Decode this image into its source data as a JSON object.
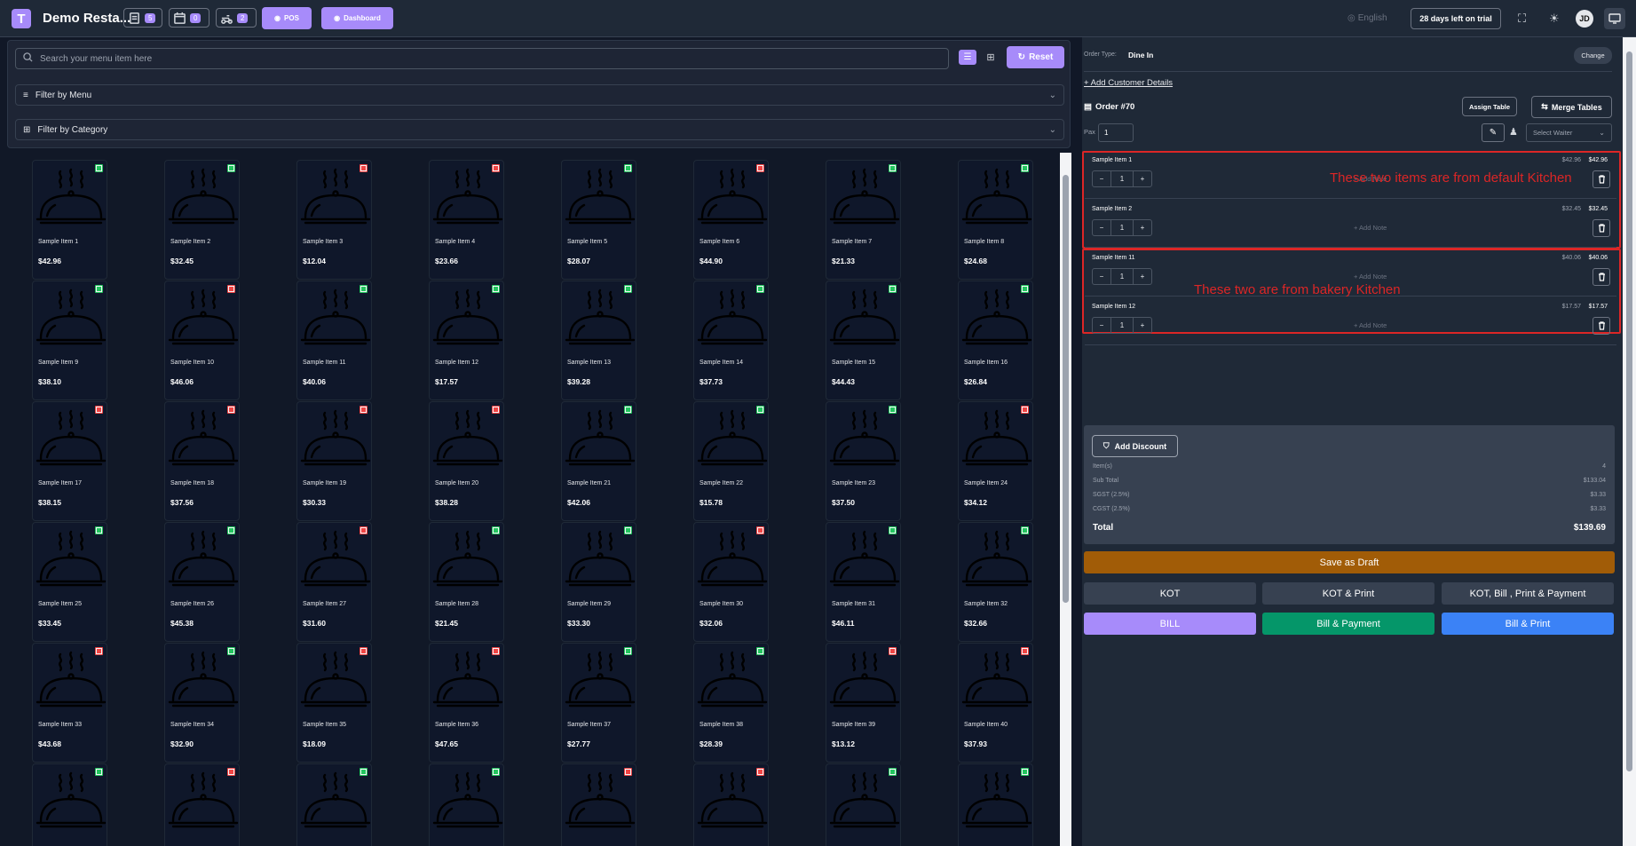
{
  "header": {
    "logo_letter": "T",
    "restaurant_name": "Demo Resta...",
    "badges": [
      {
        "icon": "receipt-icon",
        "count": "5"
      },
      {
        "icon": "calendar-icon",
        "count": "0"
      },
      {
        "icon": "delivery-icon",
        "count": "2"
      }
    ],
    "pos_label": "POS",
    "dashboard_label": "Dashboard",
    "language": "English",
    "trial": "28 days left on trial",
    "avatar": "JD"
  },
  "filters": {
    "search_placeholder": "Search your menu item here",
    "reset_label": "Reset",
    "filter_menu": "Filter by Menu",
    "filter_category": "Filter by Category"
  },
  "menu_items": [
    {
      "name": "Sample Item 1",
      "price": "$42.96",
      "veg": true
    },
    {
      "name": "Sample Item 2",
      "price": "$32.45",
      "veg": true
    },
    {
      "name": "Sample Item 3",
      "price": "$12.04",
      "veg": false
    },
    {
      "name": "Sample Item 4",
      "price": "$23.66",
      "veg": false
    },
    {
      "name": "Sample Item 5",
      "price": "$28.07",
      "veg": true
    },
    {
      "name": "Sample Item 6",
      "price": "$44.90",
      "veg": false
    },
    {
      "name": "Sample Item 7",
      "price": "$21.33",
      "veg": true
    },
    {
      "name": "Sample Item 8",
      "price": "$24.68",
      "veg": true
    },
    {
      "name": "Sample Item 9",
      "price": "$38.10",
      "veg": true
    },
    {
      "name": "Sample Item 10",
      "price": "$46.06",
      "veg": false
    },
    {
      "name": "Sample Item 11",
      "price": "$40.06",
      "veg": true
    },
    {
      "name": "Sample Item 12",
      "price": "$17.57",
      "veg": true
    },
    {
      "name": "Sample Item 13",
      "price": "$39.28",
      "veg": true
    },
    {
      "name": "Sample Item 14",
      "price": "$37.73",
      "veg": true
    },
    {
      "name": "Sample Item 15",
      "price": "$44.43",
      "veg": true
    },
    {
      "name": "Sample Item 16",
      "price": "$26.84",
      "veg": true
    },
    {
      "name": "Sample Item 17",
      "price": "$38.15",
      "veg": false
    },
    {
      "name": "Sample Item 18",
      "price": "$37.56",
      "veg": false
    },
    {
      "name": "Sample Item 19",
      "price": "$30.33",
      "veg": false
    },
    {
      "name": "Sample Item 20",
      "price": "$38.28",
      "veg": false
    },
    {
      "name": "Sample Item 21",
      "price": "$42.06",
      "veg": true
    },
    {
      "name": "Sample Item 22",
      "price": "$15.78",
      "veg": true
    },
    {
      "name": "Sample Item 23",
      "price": "$37.50",
      "veg": true
    },
    {
      "name": "Sample Item 24",
      "price": "$34.12",
      "veg": false
    },
    {
      "name": "Sample Item 25",
      "price": "$33.45",
      "veg": true
    },
    {
      "name": "Sample Item 26",
      "price": "$45.38",
      "veg": true
    },
    {
      "name": "Sample Item 27",
      "price": "$31.60",
      "veg": false
    },
    {
      "name": "Sample Item 28",
      "price": "$21.45",
      "veg": true
    },
    {
      "name": "Sample Item 29",
      "price": "$33.30",
      "veg": true
    },
    {
      "name": "Sample Item 30",
      "price": "$32.06",
      "veg": false
    },
    {
      "name": "Sample Item 31",
      "price": "$46.11",
      "veg": true
    },
    {
      "name": "Sample Item 32",
      "price": "$32.66",
      "veg": true
    },
    {
      "name": "Sample Item 33",
      "price": "$43.68",
      "veg": false
    },
    {
      "name": "Sample Item 34",
      "price": "$32.90",
      "veg": true
    },
    {
      "name": "Sample Item 35",
      "price": "$18.09",
      "veg": false
    },
    {
      "name": "Sample Item 36",
      "price": "$47.65",
      "veg": false
    },
    {
      "name": "Sample Item 37",
      "price": "$27.77",
      "veg": true
    },
    {
      "name": "Sample Item 38",
      "price": "$28.39",
      "veg": true
    },
    {
      "name": "Sample Item 39",
      "price": "$13.12",
      "veg": false
    },
    {
      "name": "Sample Item 40",
      "price": "$37.93",
      "veg": false
    },
    {
      "name": "",
      "price": "",
      "veg": true
    },
    {
      "name": "",
      "price": "",
      "veg": false
    },
    {
      "name": "",
      "price": "",
      "veg": true
    },
    {
      "name": "",
      "price": "",
      "veg": true
    },
    {
      "name": "",
      "price": "",
      "veg": false
    },
    {
      "name": "",
      "price": "",
      "veg": false
    },
    {
      "name": "",
      "price": "",
      "veg": true
    },
    {
      "name": "",
      "price": "",
      "veg": true
    }
  ],
  "order": {
    "type_label": "Order Type:",
    "type_value": "Dine In",
    "change_label": "Change",
    "add_customer": "+ Add Customer Details",
    "order_number": "Order #70",
    "assign_table": "Assign Table",
    "merge_tables": "Merge Tables",
    "pax_label": "Pax",
    "pax_value": "1",
    "waiter_placeholder": "Select Waiter",
    "note_label": "+ Add Note",
    "items": [
      {
        "name": "Sample Item 1",
        "unit_price": "$42.96",
        "total": "$42.96",
        "qty": "1"
      },
      {
        "name": "Sample Item 2",
        "unit_price": "$32.45",
        "total": "$32.45",
        "qty": "1"
      },
      {
        "name": "Sample Item 11",
        "unit_price": "$40.06",
        "total": "$40.06",
        "qty": "1"
      },
      {
        "name": "Sample Item 12",
        "unit_price": "$17.57",
        "total": "$17.57",
        "qty": "1"
      }
    ],
    "annotation_default": "These two items are from default Kitchen",
    "annotation_bakery": "These two are from bakery Kitchen"
  },
  "summary": {
    "add_discount": "Add Discount",
    "rows": [
      {
        "label": "Item(s)",
        "value": "4"
      },
      {
        "label": "Sub Total",
        "value": "$133.04"
      },
      {
        "label": "SGST (2.5%)",
        "value": "$3.33"
      },
      {
        "label": "CGST (2.5%)",
        "value": "$3.33"
      }
    ],
    "total_label": "Total",
    "total_value": "$139.69"
  },
  "actions": {
    "save_draft": "Save as Draft",
    "kot": "KOT",
    "kot_print": "KOT & Print",
    "kot_bill_print_payment": "KOT, Bill , Print & Payment",
    "bill": "BILL",
    "bill_payment": "Bill & Payment",
    "bill_print": "Bill & Print"
  },
  "colors": {
    "accent": "#a78bfa",
    "draft": "#a15c07",
    "bill_payment": "#059669",
    "bill_print": "#3b82f6",
    "veg": "#22c55e",
    "nonveg": "#ef4444",
    "annotation": "#dc2626"
  }
}
